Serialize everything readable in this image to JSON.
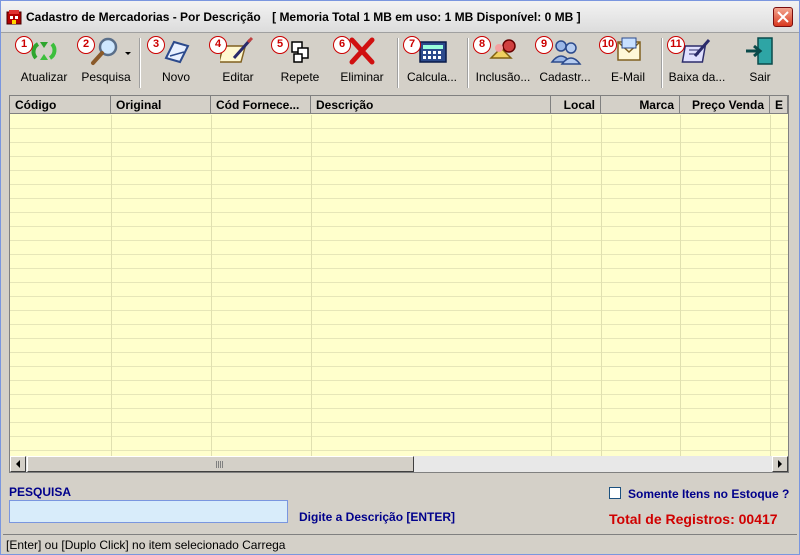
{
  "window": {
    "title": "Cadastro de Mercadorias - Por Descrição",
    "memory": "[ Memoria Total 1  MB em uso: 1 MB  Disponível: 0 MB ]"
  },
  "toolbar": [
    {
      "num": "1",
      "label": "Atualizar",
      "icon": "refresh-icon"
    },
    {
      "num": "2",
      "label": "Pesquisa",
      "icon": "search-icon"
    },
    {
      "num": "3",
      "label": "Novo",
      "icon": "new-icon"
    },
    {
      "num": "4",
      "label": "Editar",
      "icon": "edit-icon"
    },
    {
      "num": "5",
      "label": "Repete",
      "icon": "repeat-icon"
    },
    {
      "num": "6",
      "label": "Eliminar",
      "icon": "delete-icon"
    },
    {
      "num": "7",
      "label": "Calcula...",
      "icon": "calculator-icon"
    },
    {
      "num": "8",
      "label": "Inclusão...",
      "icon": "inclusion-icon"
    },
    {
      "num": "9",
      "label": "Cadastr...",
      "icon": "users-icon"
    },
    {
      "num": "10",
      "label": "E-Mail",
      "icon": "email-icon"
    },
    {
      "num": "11",
      "label": "Baixa da...",
      "icon": "download-icon"
    },
    {
      "num": "",
      "label": "Sair",
      "icon": "exit-icon"
    }
  ],
  "grid": {
    "columns": [
      "Código",
      "Original",
      "Cód Fornece...",
      "Descrição",
      "Local",
      "Marca",
      "Preço Venda",
      "E"
    ]
  },
  "search": {
    "label": "PESQUISA",
    "value": "",
    "hint": "Digite a Descrição [ENTER]"
  },
  "stock_filter": {
    "label": "Somente Itens no Estoque ?",
    "checked": false
  },
  "total": "Total de Registros: 00417",
  "status": "[Enter] ou [Duplo Click] no item selecionado Carrega",
  "colors": {
    "grid_bg": "#ffffcc",
    "accent_blue": "#00008b",
    "total_red": "#d00000",
    "number_badge": "#cc0000"
  }
}
